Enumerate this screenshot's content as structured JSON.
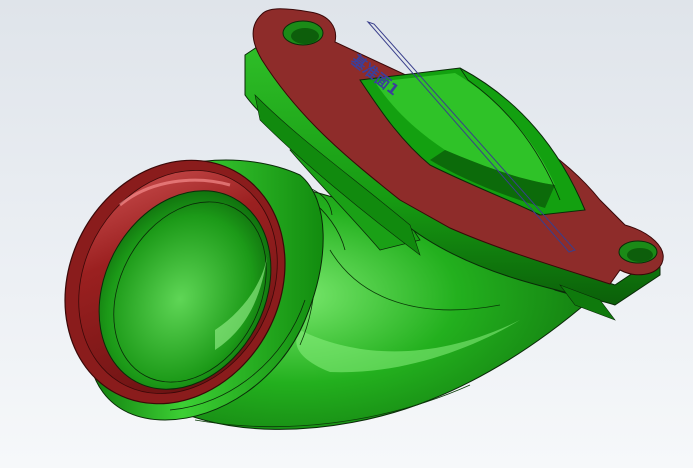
{
  "viewport": {
    "plane_label": "基准面1"
  },
  "colors": {
    "body_green": "#1fa51a",
    "body_green_light": "#6ae05e",
    "body_green_dark": "#0e6a0c",
    "face_red": "#8e2c2a",
    "face_red_dark": "#6e1414",
    "face_red_light": "#c45050",
    "edge_dark": "#0a2a08",
    "plane_line": "#3a3f8c",
    "plane_text": "#3b3f9a"
  },
  "icons": {
    "model": "elbow-intake-manifold-icon",
    "plane": "reference-plane-icon"
  }
}
